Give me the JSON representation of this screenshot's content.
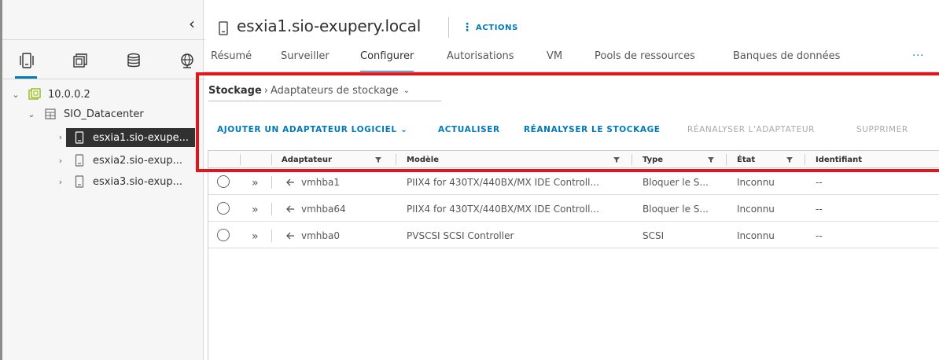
{
  "header": {
    "host_title": "esxia1.sio-exupery.local",
    "actions_label": "ACTIONS"
  },
  "tabs": [
    {
      "label": "Résumé"
    },
    {
      "label": "Surveiller"
    },
    {
      "label": "Configurer",
      "active": true
    },
    {
      "label": "Autorisations"
    },
    {
      "label": "VM"
    },
    {
      "label": "Pools de ressources"
    },
    {
      "label": "Banques de données"
    }
  ],
  "tabs_more": "···",
  "sidebar": {
    "collapse_glyph": "‹",
    "nav_icons": [
      "hosts-and-clusters-icon",
      "vms-and-templates-icon",
      "storage-icon",
      "networking-icon"
    ],
    "tree": [
      {
        "label": "10.0.0.2",
        "caret": "⌄",
        "icon": "vcenter-icon"
      },
      {
        "label": "SIO_Datacenter",
        "caret": "⌄",
        "icon": "datacenter-icon"
      },
      {
        "label": "esxia1.sio-exupe...",
        "caret": "›",
        "icon": "host-icon",
        "selected": true
      },
      {
        "label": "esxia2.sio-exup...",
        "caret": "›",
        "icon": "host-icon"
      },
      {
        "label": "esxia3.sio-exup...",
        "caret": "›",
        "icon": "host-icon"
      }
    ]
  },
  "breadcrumb": {
    "root": "Stockage",
    "separator": "›",
    "current": "Adaptateurs de stockage",
    "chevron": "⌄"
  },
  "toolbar": {
    "add_adapter": "AJOUTER UN ADAPTATEUR LOGICIEL ⌄",
    "refresh": "ACTUALISER",
    "rescan_storage": "RÉANALYSER LE STOCKAGE",
    "rescan_adapter": "RÉANALYSER L'ADAPTATEUR",
    "delete": "SUPPRIMER"
  },
  "grid": {
    "columns": {
      "adapter": "Adaptateur",
      "model": "Modèle",
      "type": "Type",
      "status": "État",
      "identifier": "Identifiant"
    },
    "expander_glyph": "»",
    "rows": [
      {
        "adapter": "vmhba1",
        "model": "PIIX4 for 430TX/440BX/MX IDE Controll...",
        "type": "Bloquer le S...",
        "status": "Inconnu",
        "identifier": "--"
      },
      {
        "adapter": "vmhba64",
        "model": "PIIX4 for 430TX/440BX/MX IDE Controll...",
        "type": "Bloquer le S...",
        "status": "Inconnu",
        "identifier": "--"
      },
      {
        "adapter": "vmhba0",
        "model": "PVSCSI SCSI Controller",
        "type": "SCSI",
        "status": "Inconnu",
        "identifier": "--"
      }
    ]
  },
  "colors": {
    "accent": "#0079b8",
    "highlight": "#e2141c",
    "selected_bg": "#313131"
  }
}
